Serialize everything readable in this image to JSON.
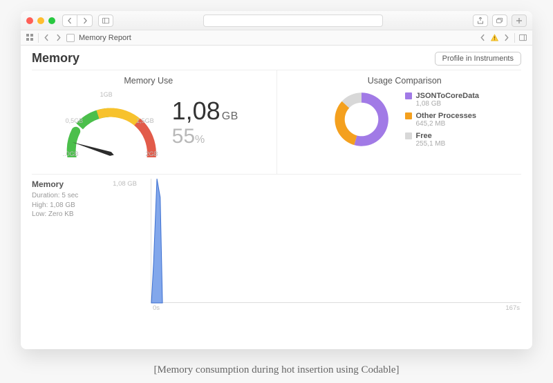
{
  "toolbar2": {
    "title": "Memory Report"
  },
  "header": {
    "title": "Memory",
    "profile_button": "Profile in Instruments"
  },
  "gauge": {
    "title": "Memory Use",
    "value": "1,08",
    "unit": "GB",
    "percent": "55",
    "percent_unit": "%",
    "ticks": {
      "t0": "..0GB",
      "t05": "0,5GB",
      "t1": "1GB",
      "t15": "1,5GB",
      "t2": "2GB"
    }
  },
  "usage": {
    "title": "Usage Comparison",
    "items": [
      {
        "name": "JSONToCoreData",
        "value": "1,08 GB",
        "color": "#a17ae6"
      },
      {
        "name": "Other Processes",
        "value": "645,2 MB",
        "color": "#f4a01e"
      },
      {
        "name": "Free",
        "value": "255,1 MB",
        "color": "#d8d8d8"
      }
    ]
  },
  "timeline": {
    "title": "Memory",
    "duration": "Duration: 5 sec",
    "high": "High: 1,08 GB",
    "low": "Low: Zero KB",
    "ymax": "1,08 GB",
    "x0": "0s",
    "x1": "167s"
  },
  "caption": "[Memory consumption during hot insertion using Codable]",
  "chart_data": {
    "gauge": {
      "type": "gauge",
      "range_gb": [
        0,
        2
      ],
      "value_gb": 1.08,
      "percent": 55,
      "ticks_gb": [
        0,
        0.5,
        1.0,
        1.5,
        2.0
      ],
      "segments": [
        {
          "from_gb": 0.0,
          "to_gb": 0.65,
          "color": "#4bbf4b"
        },
        {
          "from_gb": 0.65,
          "to_gb": 1.35,
          "color": "#f7c22d"
        },
        {
          "from_gb": 1.35,
          "to_gb": 2.0,
          "color": "#e25b4a"
        }
      ]
    },
    "usage_donut": {
      "type": "pie",
      "title": "Usage Comparison",
      "series": [
        {
          "name": "JSONToCoreData",
          "value_mb": 1080,
          "color": "#a17ae6"
        },
        {
          "name": "Other Processes",
          "value_mb": 645.2,
          "color": "#f4a01e"
        },
        {
          "name": "Free",
          "value_mb": 255.1,
          "color": "#d8d8d8"
        }
      ]
    },
    "memory_timeline": {
      "type": "area",
      "xlabel": "seconds",
      "ylabel": "Memory (GB)",
      "xlim": [
        0,
        167
      ],
      "ylim": [
        0,
        1.08
      ],
      "series": [
        {
          "name": "Memory",
          "color": "#5b8ee6",
          "points": [
            {
              "x": 0,
              "y": 0
            },
            {
              "x": 1,
              "y": 0.35
            },
            {
              "x": 2.5,
              "y": 1.08
            },
            {
              "x": 4,
              "y": 0.92
            },
            {
              "x": 5,
              "y": 0
            }
          ]
        }
      ],
      "duration_sec": 5,
      "high_gb": 1.08,
      "low_gb": 0
    }
  }
}
